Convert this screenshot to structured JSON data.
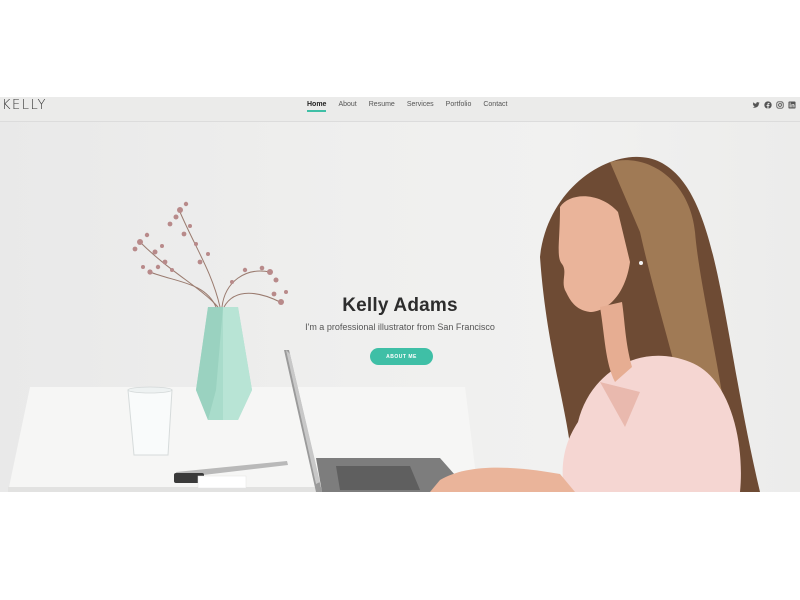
{
  "header": {
    "logo": "KELLY",
    "nav": [
      {
        "label": "Home",
        "active": true
      },
      {
        "label": "About"
      },
      {
        "label": "Resume"
      },
      {
        "label": "Services"
      },
      {
        "label": "Portfolio"
      },
      {
        "label": "Contact"
      }
    ],
    "social_icons": [
      "twitter-icon",
      "facebook-icon",
      "instagram-icon",
      "linkedin-icon"
    ]
  },
  "hero": {
    "title": "Kelly Adams",
    "subtitle": "I'm a professional illustrator from San Francisco",
    "button_label": "ABOUT ME"
  },
  "colors": {
    "accent": "#3fbfa6",
    "nav_bg": "#ebebea",
    "hero_bg": "#ececec",
    "text_dark": "#2d2d2d"
  }
}
